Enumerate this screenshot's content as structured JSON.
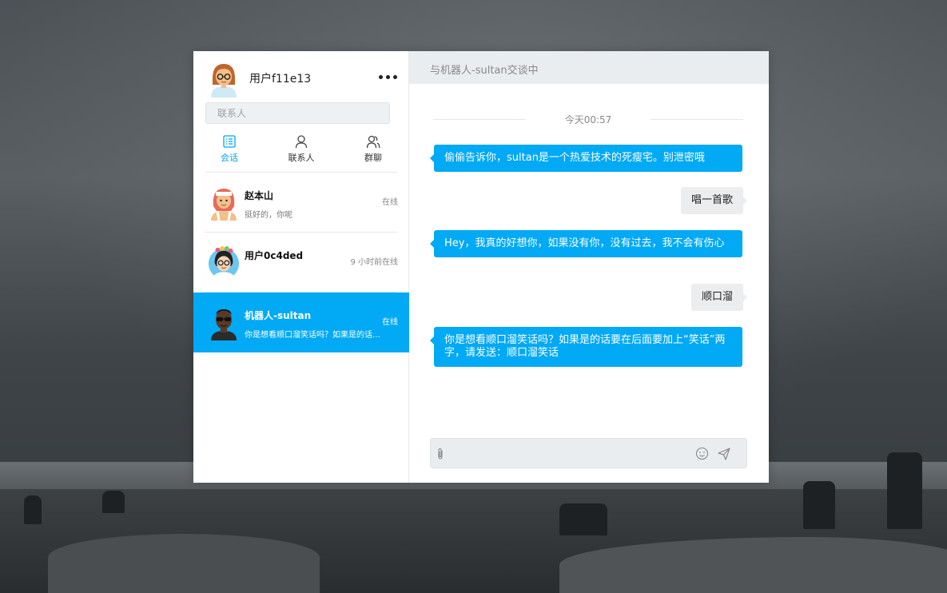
{
  "user": {
    "name": "用户f11e13"
  },
  "search": {
    "placeholder": "联系人"
  },
  "tabs": [
    {
      "label": "会话",
      "icon": "chat-list-icon",
      "active": true
    },
    {
      "label": "联系人",
      "icon": "contact-icon",
      "active": false
    },
    {
      "label": "群聊",
      "icon": "group-icon",
      "active": false
    }
  ],
  "conversations": [
    {
      "name": "赵本山",
      "preview": "挺好的，你呢",
      "status": "在线",
      "avatar": "red-hair-avatar"
    },
    {
      "name": "用户0c4ded",
      "preview": "",
      "status": "9 小时前在线",
      "avatar": "flower-glasses-avatar"
    },
    {
      "name": "机器人-sultan",
      "preview": "你是想看顺口溜笑话吗？如果是的话要在后面要加上“笑话”两字，请发送：顺口溜笑话",
      "status": "在线",
      "avatar": "sunglasses-avatar",
      "active": true
    }
  ],
  "chat": {
    "title": "与机器人-sultan交谈中",
    "time_divider": "今天00:57",
    "messages": [
      {
        "from": "bot",
        "text": "偷偷告诉你，sultan是一个热爱技术的死瘦宅。别泄密哦"
      },
      {
        "from": "me",
        "text": "唱一首歌"
      },
      {
        "from": "bot",
        "text": "Hey，我真的好想你，如果没有你，没有过去，我不会有伤心"
      },
      {
        "from": "me",
        "text": "顺口溜"
      },
      {
        "from": "bot",
        "text": "你是想看顺口溜笑话吗？如果是的话要在后面要加上“笑话”两字，请发送：顺口溜笑话"
      }
    ],
    "input_value": ""
  },
  "colors": {
    "accent": "#02a9f4",
    "header_bg": "#eaedf0",
    "bubble_me": "#ecedef"
  }
}
